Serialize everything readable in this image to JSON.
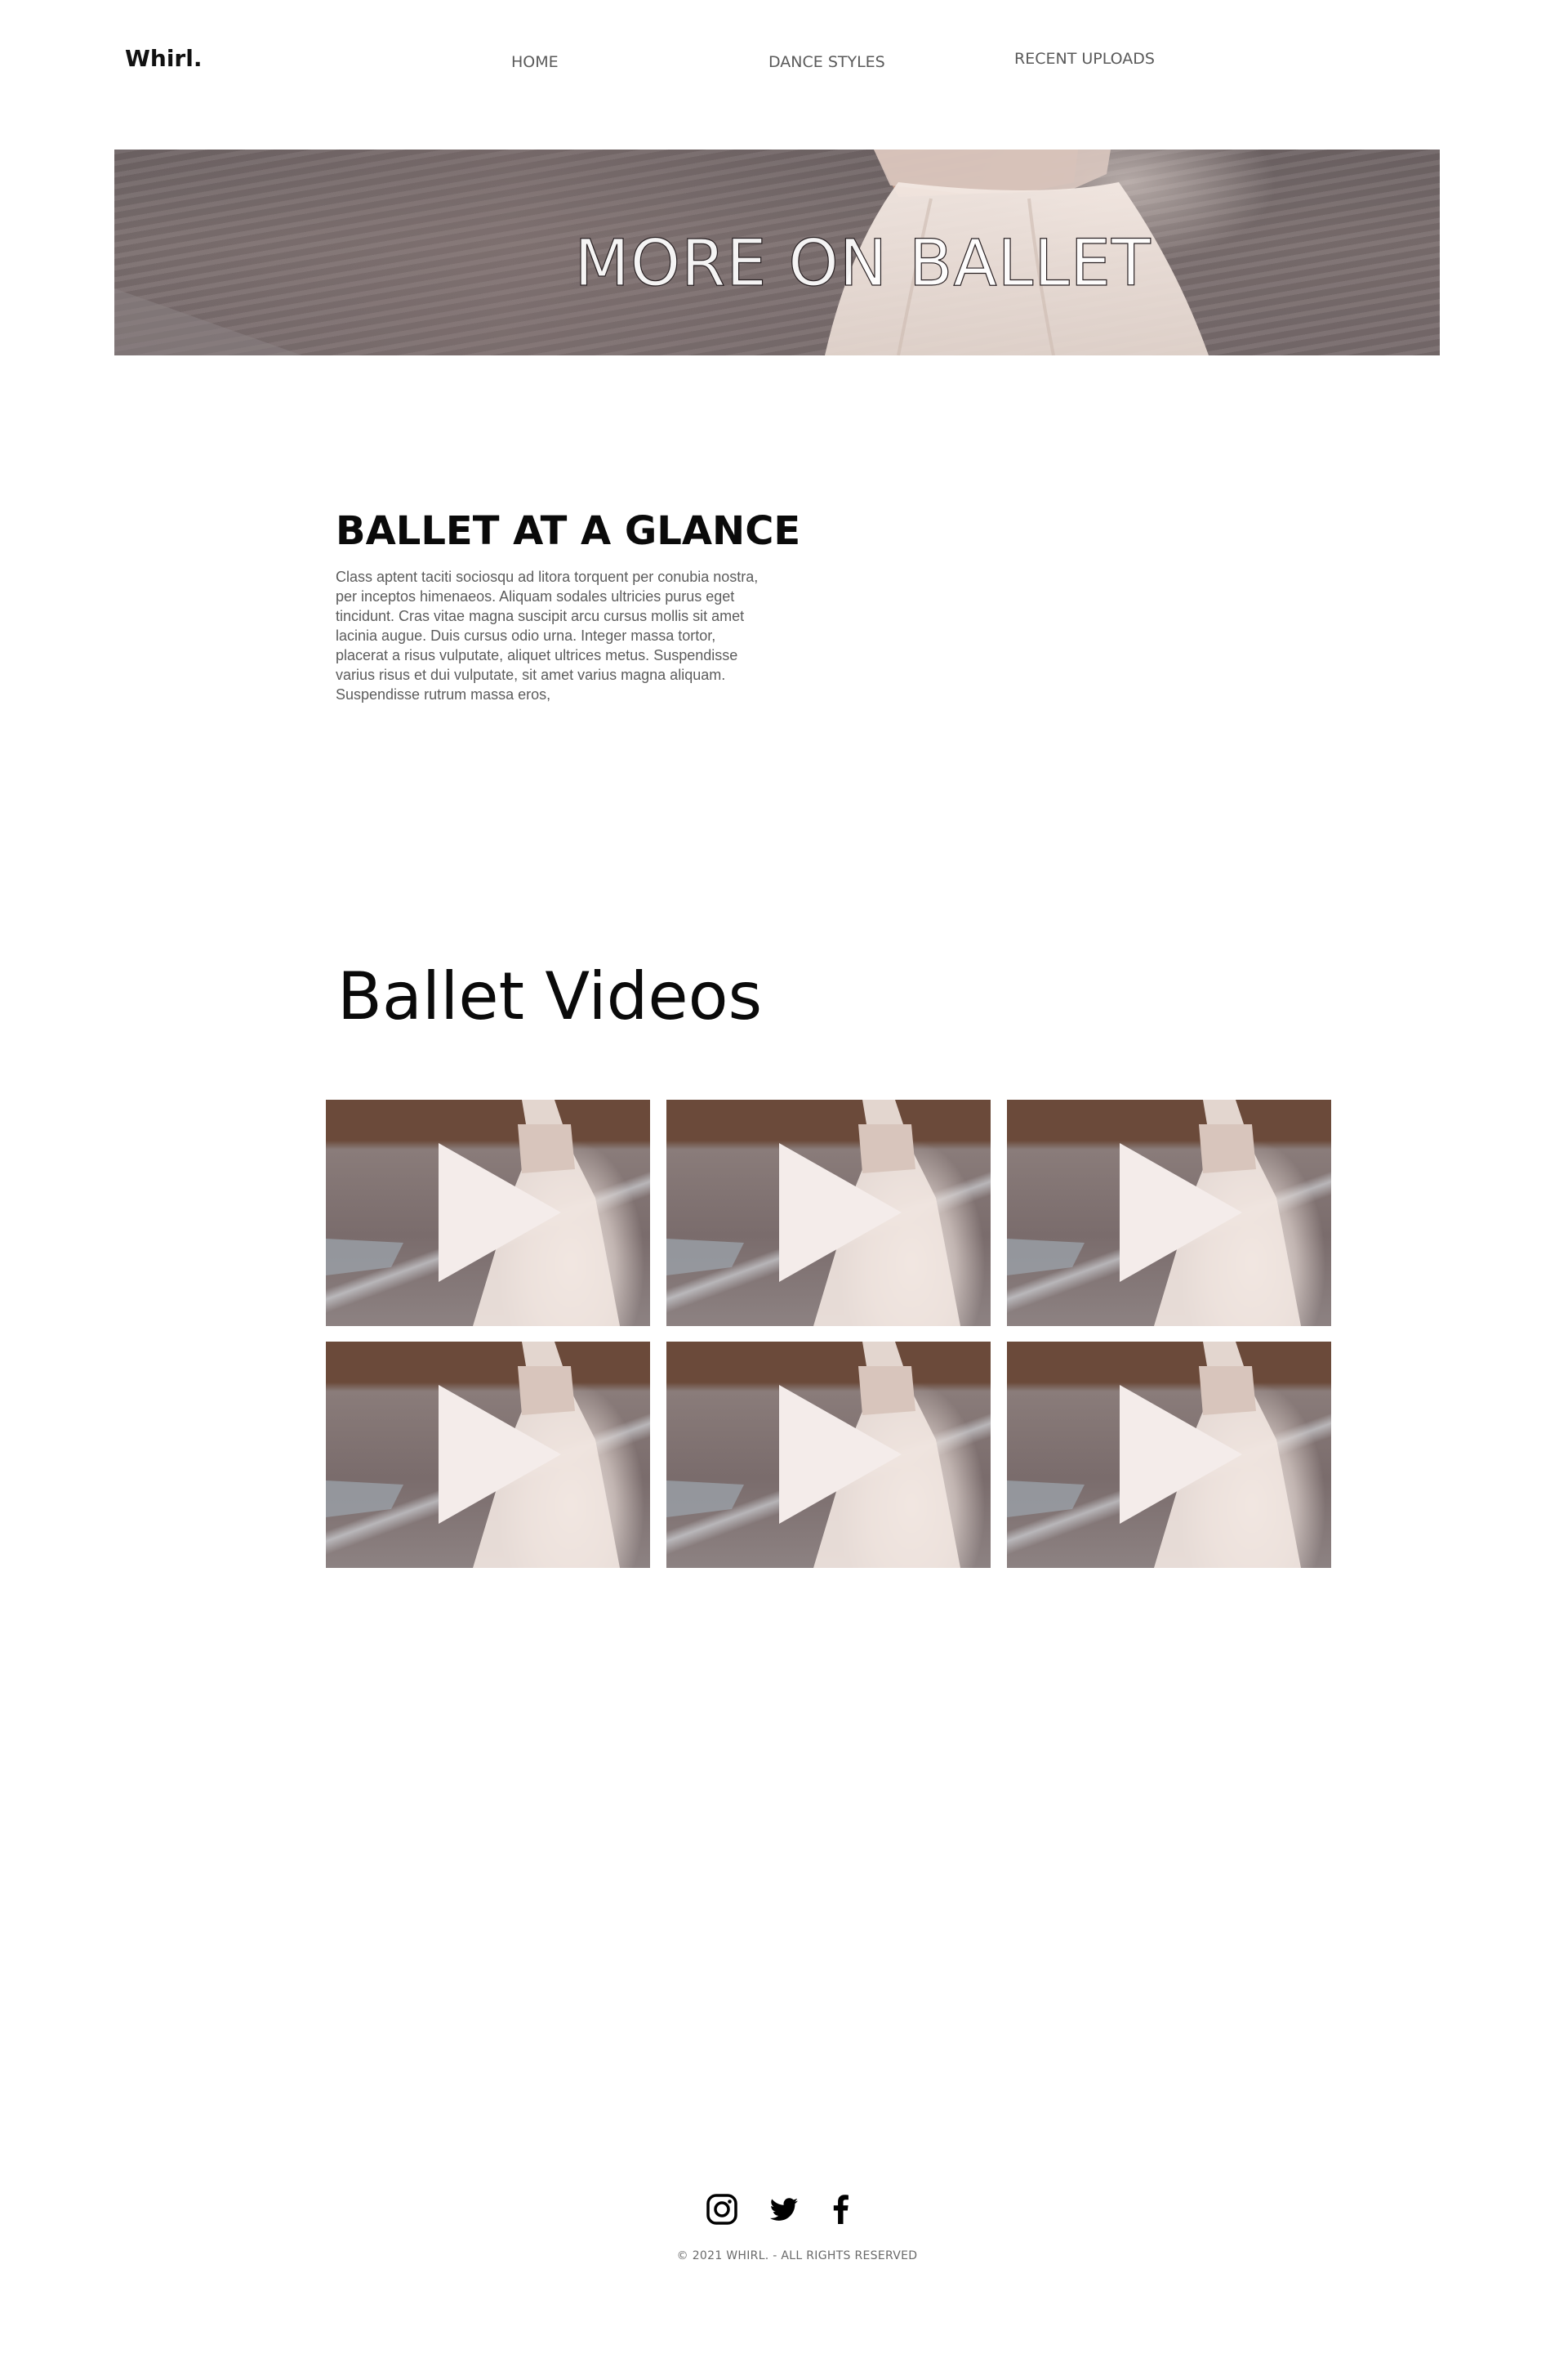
{
  "header": {
    "logo": "Whirl.",
    "nav": [
      {
        "label": "HOME"
      },
      {
        "label": "DANCE STYLES"
      },
      {
        "label": "RECENT UPLOADS"
      }
    ]
  },
  "hero": {
    "title": "MORE ON BALLET"
  },
  "about": {
    "title": "BALLET AT A GLANCE",
    "text": "Class aptent taciti sociosqu ad litora torquent per conubia nostra, per inceptos himenaeos. Aliquam sodales ultricies purus eget tincidunt. Cras vitae magna suscipit arcu cursus mollis sit amet lacinia augue. Duis cursus odio urna. Integer massa tortor, placerat a risus vulputate, aliquet ultrices metus. Suspendisse varius risus et dui vulputate, sit amet varius magna aliquam. Suspendisse rutrum massa eros,"
  },
  "videos": {
    "title": "Ballet Videos",
    "count": 6,
    "play_icon": "play-icon"
  },
  "footer": {
    "social_icons": [
      "instagram-icon",
      "twitter-icon",
      "facebook-icon"
    ],
    "copyright": "© 2021 WHIRL. - ALL RIGHTS RESERVED"
  },
  "colors": {
    "play_icon_fill": "#f4ecea",
    "nav_text": "#5a5a5a",
    "body_text": "#5c5c5c"
  }
}
